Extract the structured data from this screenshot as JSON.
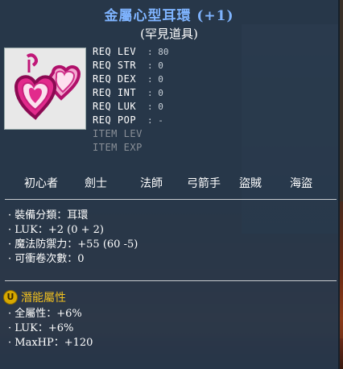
{
  "item": {
    "name": "金屬心型耳環 (+1)",
    "rarity_label": "(罕見道具)",
    "icon": "pink-heart-earring-icon"
  },
  "requirements": [
    {
      "label": "REQ LEV",
      "value": ": 80",
      "state": "on"
    },
    {
      "label": "REQ STR",
      "value": ": 0",
      "state": "on"
    },
    {
      "label": "REQ DEX",
      "value": ": 0",
      "state": "on"
    },
    {
      "label": "REQ INT",
      "value": ": 0",
      "state": "on"
    },
    {
      "label": "REQ LUK",
      "value": ": 0",
      "state": "on"
    },
    {
      "label": "REQ POP",
      "value": ": -",
      "state": "on"
    },
    {
      "label": "ITEM LEV",
      "value": "",
      "state": "off"
    },
    {
      "label": "ITEM EXP",
      "value": "",
      "state": "off"
    }
  ],
  "jobs": [
    "初心者",
    "劍士",
    "法師",
    "弓箭手",
    "盜賊",
    "海盜"
  ],
  "stats": [
    "· 裝備分類：耳環",
    "· LUK：+2 (0 + 2)",
    "· 魔法防禦力：+55 (60 -5)",
    "· 可衝卷次數：0"
  ],
  "potential": {
    "badge": "U",
    "title": "潛能屬性",
    "lines": [
      "· 全屬性：+6%",
      "· LUK：+6%",
      "· MaxHP：+120"
    ]
  },
  "colors": {
    "title": "#7fb4ff",
    "potential": "#f0c020",
    "panel": "#26384c"
  }
}
